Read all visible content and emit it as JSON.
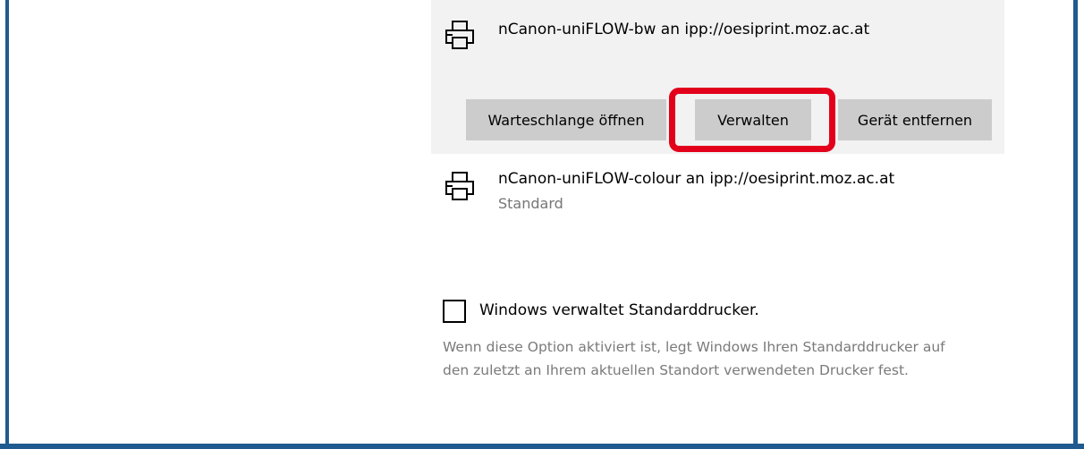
{
  "printers": [
    {
      "name": "nCanon-uniFLOW-bw an ipp://oesiprint.moz.ac.at",
      "status": "",
      "icon": "printer-icon",
      "selected": true
    },
    {
      "name": "nCanon-uniFLOW-colour an ipp://oesiprint.moz.ac.at",
      "status": "Standard",
      "icon": "printer-icon",
      "selected": false
    }
  ],
  "actions": {
    "open_queue_label": "Warteschlange öffnen",
    "manage_label": "Verwalten",
    "remove_device_label": "Gerät entfernen"
  },
  "default_printer_setting": {
    "checkbox_label": "Windows verwaltet Standarddrucker.",
    "checked": false,
    "description": "Wenn diese Option aktiviert ist, legt Windows Ihren Standarddrucker auf den zuletzt an Ihrem aktuellen Standort verwendeten Drucker fest."
  },
  "colors": {
    "highlight": "#e3001b",
    "frame": "#1f5b8e",
    "selected_bg": "#f2f2f2",
    "button_bg": "#cccccc"
  }
}
